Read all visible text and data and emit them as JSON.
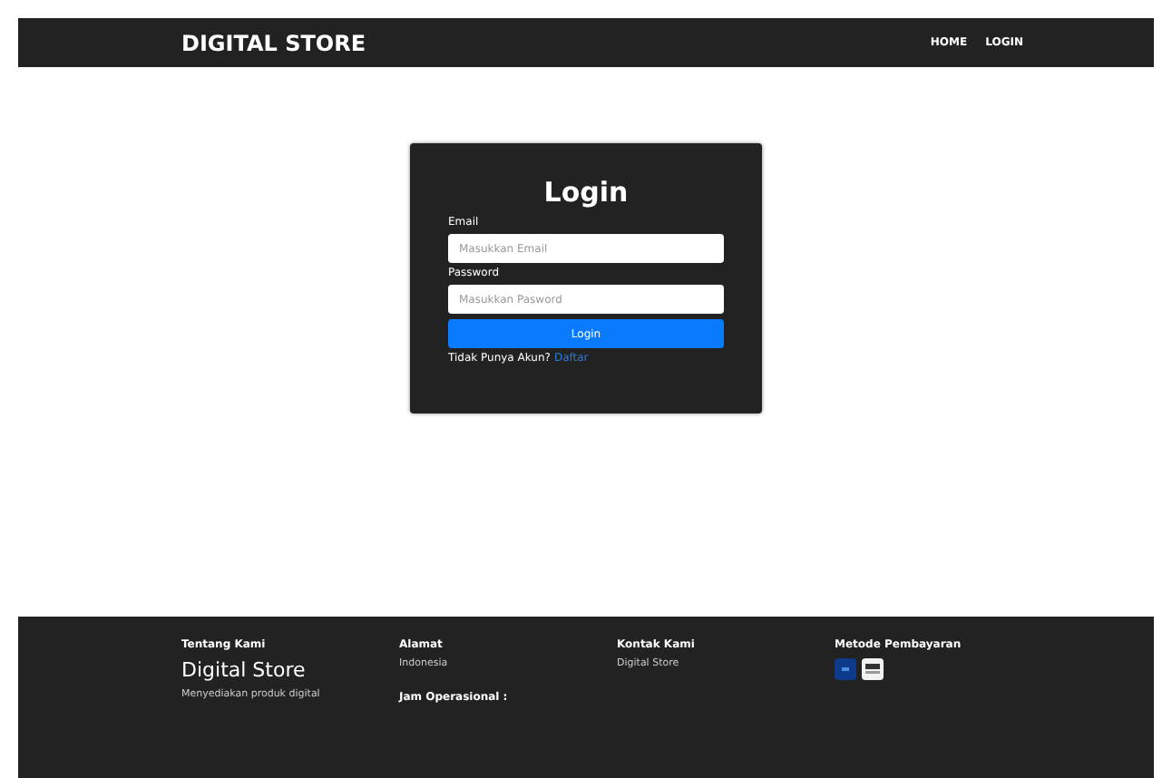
{
  "navbar": {
    "brand": "DIGITAL STORE",
    "links": [
      "HOME",
      "LOGIN"
    ]
  },
  "login": {
    "title": "Login",
    "fields": [
      {
        "label": "Email",
        "placeholder": "Masukkan Email"
      },
      {
        "label": "Password",
        "placeholder": "Masukkan Pasword"
      }
    ],
    "button": "Login",
    "register_prompt": "Tidak Punya Akun?",
    "register_link": "Daftar"
  },
  "footer": {
    "about": {
      "heading": "Tentang Kami",
      "name": "Digital Store",
      "text": "Menyediakan produk digital"
    },
    "address": {
      "heading": "Alamat",
      "text": "Indonesia",
      "hours_heading": "Jam Operasional :"
    },
    "contact": {
      "heading": "Kontak Kami",
      "text": "Digital Store"
    },
    "payment": {
      "heading": "Metode Pembayaran"
    }
  }
}
